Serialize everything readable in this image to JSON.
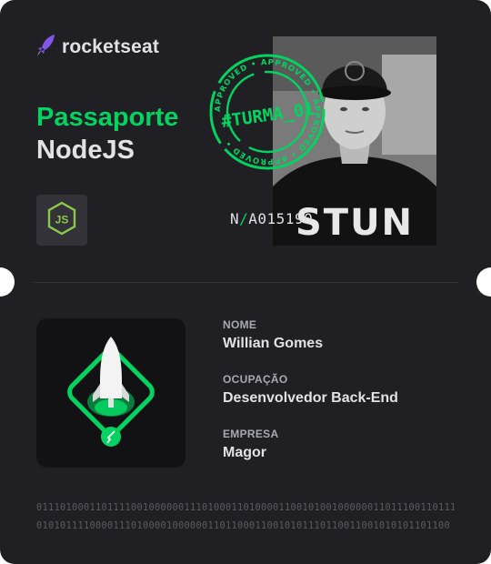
{
  "brand": {
    "name": "rocketseat",
    "accent": "#8257e5"
  },
  "passport": {
    "title_line1": "Passaporte",
    "title_line2": "NodeJS",
    "tech_icon": "nodejs-icon",
    "number_prefix": "N",
    "number_separator": "/",
    "number_value": "A015190"
  },
  "stamp": {
    "text": "#TURMA_01",
    "ring_text": "APPROVED • APPROVED • APPROVED • APPROVED • "
  },
  "holder": {
    "photo": "profile-photo",
    "fields": [
      {
        "label": "Nome",
        "value": "Willian Gomes"
      },
      {
        "label": "Ocupação",
        "value": "Desenvolvedor Back-End"
      },
      {
        "label": "Empresa",
        "value": "Magor"
      }
    ]
  },
  "badge_icon": "rocket-badge-icon",
  "binary": {
    "line1": "0111010001101111001000000111010001101000011001010010000001101110011011100110",
    "line2": "0101011110000111010000100000011011000110010101110110011001010101101100"
  },
  "colors": {
    "background": "#202024",
    "green": "#04d361",
    "text": "#e1e1e6",
    "muted": "#a8a8b3"
  }
}
